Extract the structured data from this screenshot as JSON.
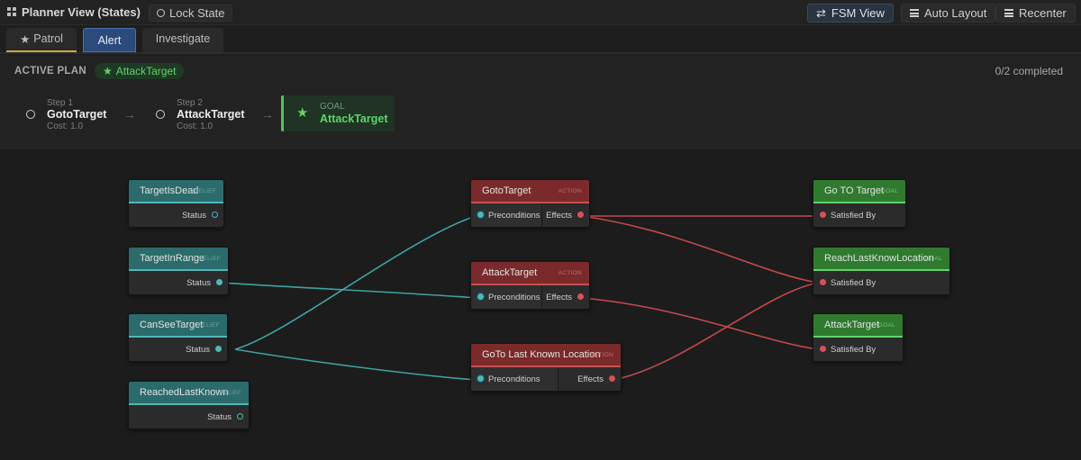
{
  "header": {
    "title": "Planner View (States)",
    "lock_label": "Lock State",
    "fsm_view_label": "FSM View",
    "auto_layout_label": "Auto Layout",
    "recenter_label": "Recenter"
  },
  "tabs": [
    {
      "label": "Patrol",
      "icon": "star-icon"
    },
    {
      "label": "Alert"
    },
    {
      "label": "Investigate"
    }
  ],
  "plan": {
    "label": "ACTIVE PLAN",
    "chip": "AttackTarget",
    "progress": "0/2 completed",
    "steps": [
      {
        "sub": "Step 1",
        "name": "GotoTarget",
        "cost": "Cost: 1.0"
      },
      {
        "sub": "Step 2",
        "name": "AttackTarget",
        "cost": "Cost: 1.0"
      }
    ],
    "goal": {
      "label": "GOAL",
      "name": "AttackTarget"
    }
  },
  "nodes": {
    "beliefs": [
      {
        "title": "TargetIsDead",
        "tag": "BELIEF",
        "port_label": "Status"
      },
      {
        "title": "TargetInRange",
        "tag": "BELIEF",
        "port_label": "Status"
      },
      {
        "title": "CanSeeTarget",
        "tag": "BELIEF",
        "port_label": "Status"
      },
      {
        "title": "ReachedLastKnown",
        "tag": "BELIEF",
        "port_label": "Status"
      }
    ],
    "actions": [
      {
        "title": "GotoTarget",
        "tag": "ACTION",
        "in_label": "Preconditions",
        "out_label": "Effects"
      },
      {
        "title": "AttackTarget",
        "tag": "ACTION",
        "in_label": "Preconditions",
        "out_label": "Effects"
      },
      {
        "title": "GoTo Last Known Location",
        "tag": "ACTION",
        "in_label": "Preconditions",
        "out_label": "Effects"
      }
    ],
    "goals": [
      {
        "title": "Go TO Target",
        "tag": "GOAL",
        "in_label": "Satisfied By"
      },
      {
        "title": "ReachLastKnowLocation",
        "tag": "GOAL",
        "in_label": "Satisfied By"
      },
      {
        "title": "AttackTarget",
        "tag": "GOAL",
        "in_label": "Satisfied By"
      }
    ]
  },
  "colors": {
    "belief": "#2b6b6b",
    "action": "#7a2a2a",
    "goal": "#2f7a2f",
    "belief_wire": "#3fa3a3",
    "action_wire": "#c44a4a",
    "accent": "#5fd36b"
  }
}
